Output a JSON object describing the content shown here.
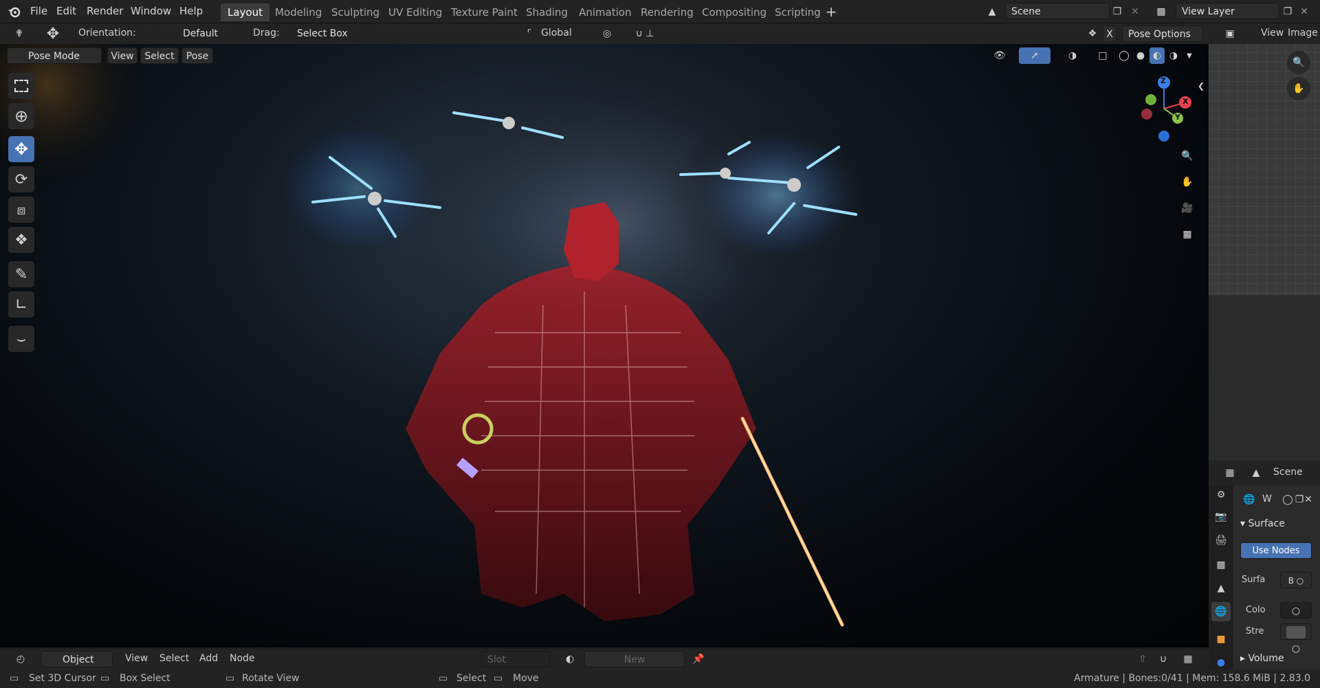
{
  "menus": [
    "File",
    "Edit",
    "Render",
    "Window",
    "Help"
  ],
  "workspaces": [
    "Layout",
    "Modeling",
    "Sculpting",
    "UV Editing",
    "Texture Paint",
    "Shading",
    "Animation",
    "Rendering",
    "Compositing",
    "Scripting"
  ],
  "scene": {
    "name": "Scene"
  },
  "view_layer": {
    "name": "View Layer"
  },
  "tool_header": {
    "orientation_label": "Orientation:",
    "orientation_value": "Default",
    "drag_label": "Drag:",
    "drag_value": "Select Box",
    "transform_orientation": "Global",
    "pose_options": "Pose Options",
    "x_label": "X"
  },
  "viewport_header": {
    "mode": "Pose Mode",
    "menus": [
      "View",
      "Select",
      "Pose"
    ]
  },
  "gizmo": {
    "z": "Z",
    "x": "X",
    "y": "Y"
  },
  "image_editor": {
    "view": "View",
    "image": "Image"
  },
  "properties": {
    "scene_label": "Scene",
    "world_name": "W",
    "surface_panel": "Surface",
    "use_nodes": "Use Nodes",
    "surface_label": "Surfa",
    "surface_value": "B",
    "color_label": "Colo",
    "strength_label": "Stre",
    "volume_panel": "Volume"
  },
  "shader_header": {
    "object_type": "Object",
    "menus": [
      "View",
      "Select",
      "Add",
      "Node"
    ],
    "slot": "Slot",
    "new_label": "New"
  },
  "status": {
    "set_cursor": "Set 3D Cursor",
    "box_select": "Box Select",
    "rotate_view": "Rotate View",
    "select": "Select",
    "move": "Move",
    "info": "Armature | Bones:0/41 | Mem: 158.6 MiB | 2.83.0"
  },
  "colors": {
    "accent": "#4772b3",
    "background": "#1d1d1d",
    "header": "#232323"
  }
}
